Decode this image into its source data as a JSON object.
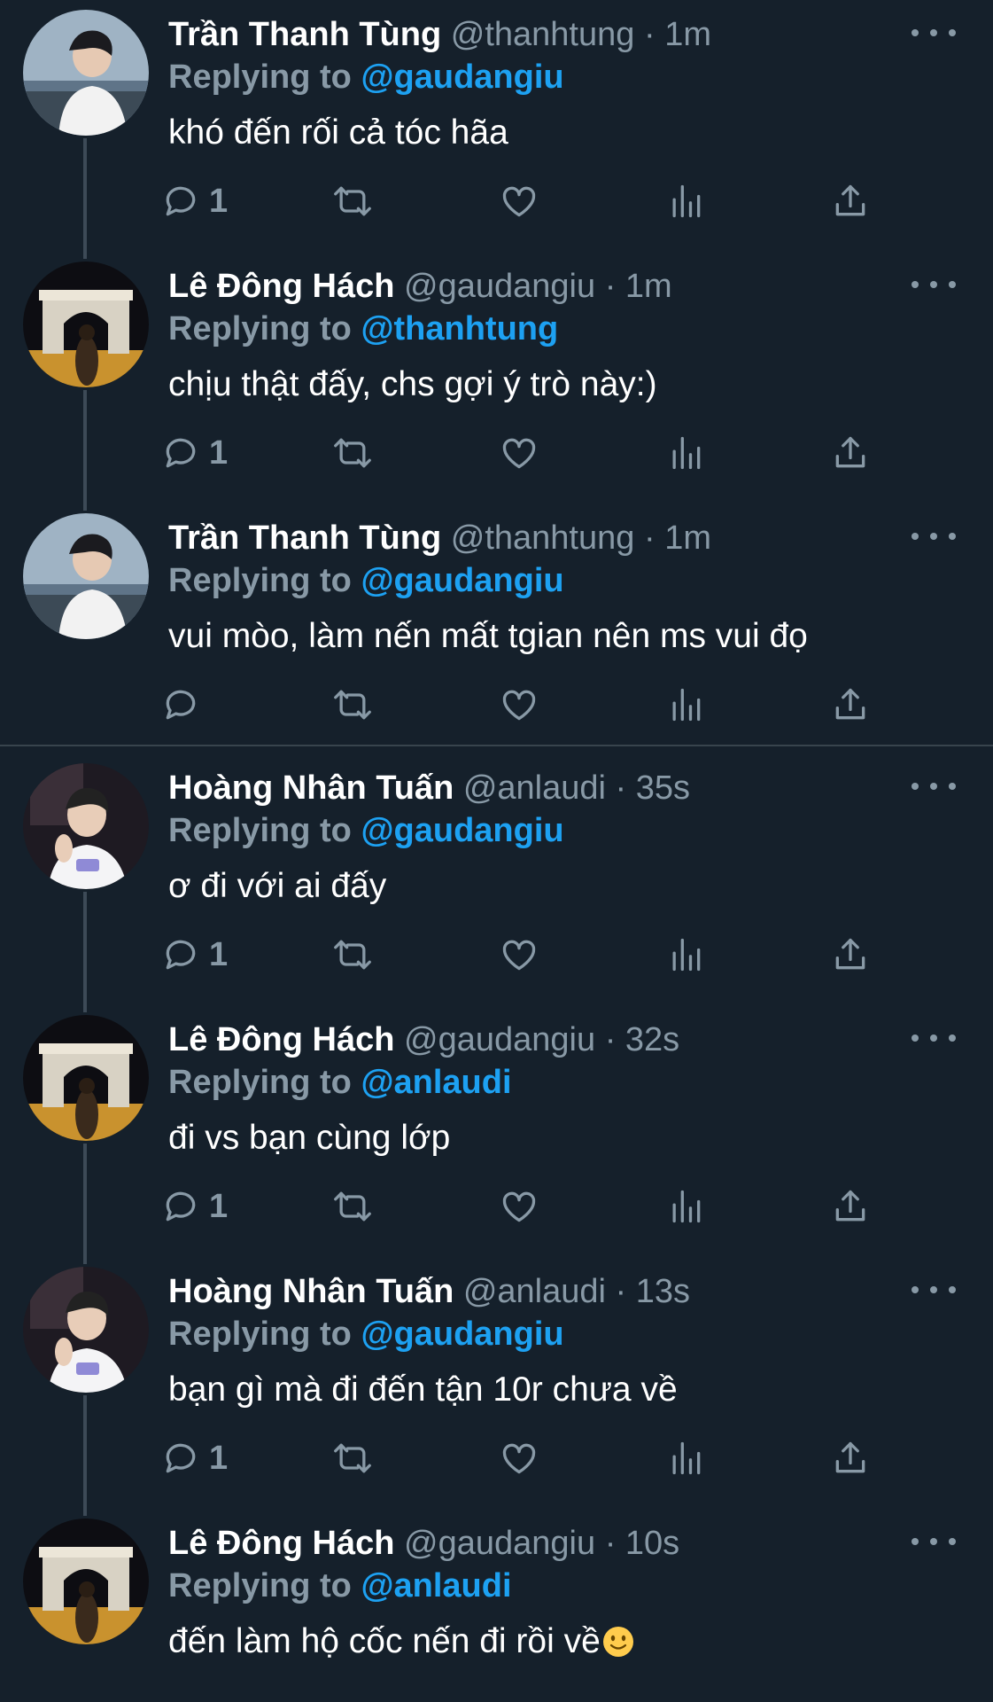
{
  "labels": {
    "replying_to": "Replying to",
    "dot": "·"
  },
  "colors": {
    "background": "#15202b",
    "muted": "#8899a6",
    "link": "#1da1f2",
    "text": "#ffffff",
    "thread": "#3d4a57"
  },
  "tweets": [
    {
      "name": "Trần Thanh Tùng",
      "handle": "@thanhtung",
      "time": "1m",
      "replying_to": "@gaudangiu",
      "text": "khó đến rối cả tóc hãa",
      "reply_count": "1",
      "avatar": "portrait-boy-sea"
    },
    {
      "name": "Lê Đông Hách",
      "handle": "@gaudangiu",
      "time": "1m",
      "replying_to": "@thanhtung",
      "text": "chịu thật đấy, chs gợi ý trò này:)",
      "reply_count": "1",
      "avatar": "arc-de-triomphe-night"
    },
    {
      "name": "Trần Thanh Tùng",
      "handle": "@thanhtung",
      "time": "1m",
      "replying_to": "@gaudangiu",
      "text": "vui mòo, làm nến mất tgian nên ms vui đọ",
      "reply_count": "",
      "avatar": "portrait-boy-sea"
    },
    {
      "name": "Hoàng Nhân Tuấn",
      "handle": "@anlaudi",
      "time": "35s",
      "replying_to": "@gaudangiu",
      "text": "ơ đi với ai đấy",
      "reply_count": "1",
      "avatar": "portrait-boy-white-tee"
    },
    {
      "name": "Lê Đông Hách",
      "handle": "@gaudangiu",
      "time": "32s",
      "replying_to": "@anlaudi",
      "text": "đi vs bạn cùng lớp",
      "reply_count": "1",
      "avatar": "arc-de-triomphe-night"
    },
    {
      "name": "Hoàng Nhân Tuấn",
      "handle": "@anlaudi",
      "time": "13s",
      "replying_to": "@gaudangiu",
      "text": "bạn gì mà đi đến tận 10r chưa về",
      "reply_count": "1",
      "avatar": "portrait-boy-white-tee"
    },
    {
      "name": "Lê Đông Hách",
      "handle": "@gaudangiu",
      "time": "10s",
      "replying_to": "@anlaudi",
      "text": "đến làm hộ cốc nến đi rồi về",
      "reply_count": "",
      "avatar": "arc-de-triomphe-night",
      "trailing_emoji": "slightly-smiling-face-icon"
    }
  ]
}
